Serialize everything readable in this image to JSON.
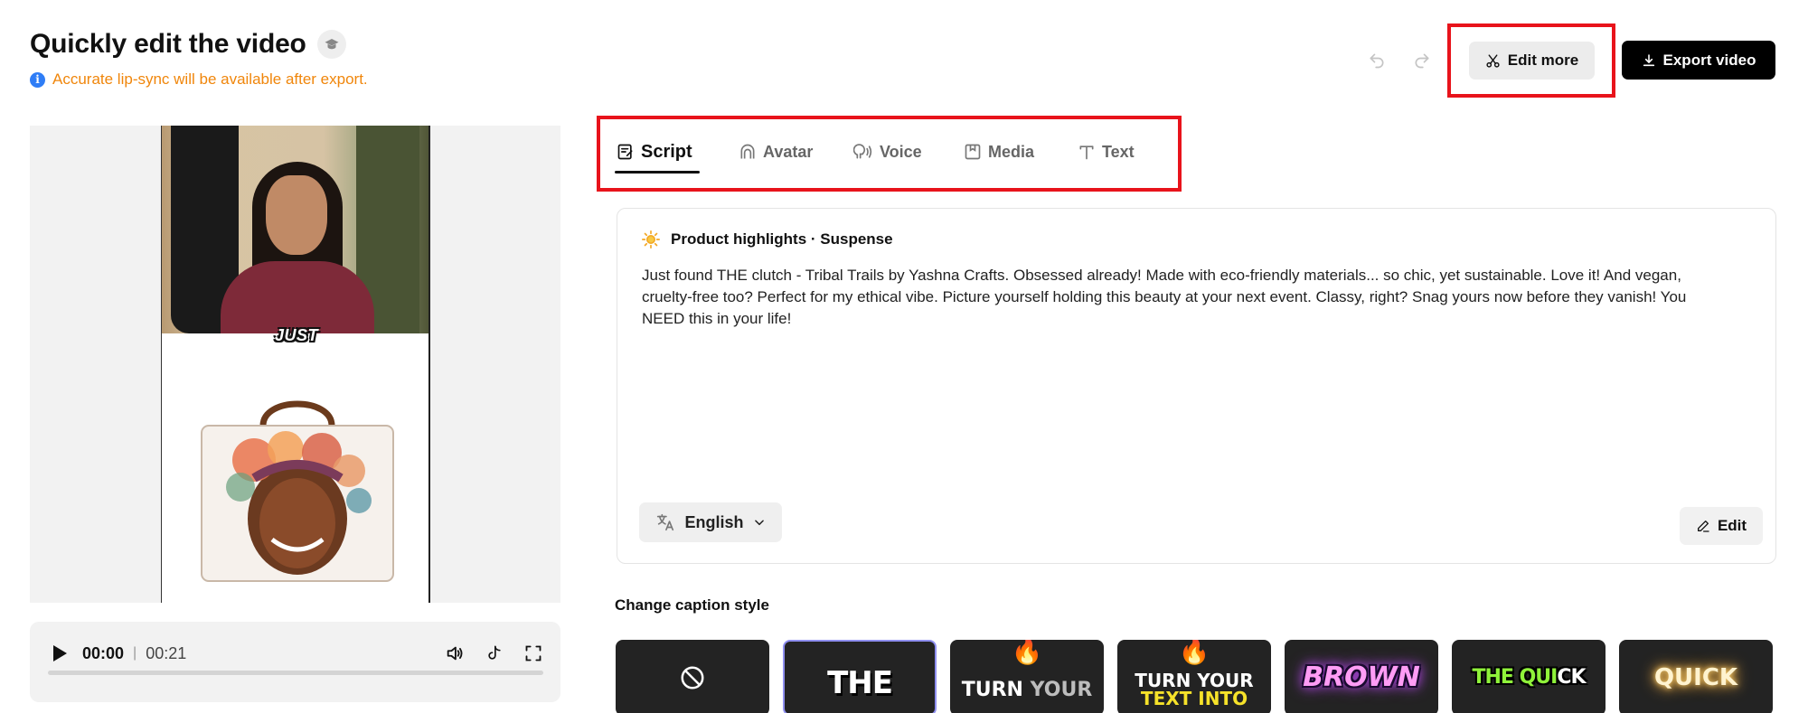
{
  "header": {
    "title": "Quickly edit the video",
    "notice": "Accurate lip-sync will be available after export.",
    "edit_more_label": "Edit more",
    "export_label": "Export video"
  },
  "preview": {
    "caption_overlay": "JUST"
  },
  "player": {
    "current_time": "00:00",
    "separator": "|",
    "total_time": "00:21",
    "progress": 0
  },
  "tabs": [
    {
      "label": "Script",
      "icon": "script-icon",
      "active": true
    },
    {
      "label": "Avatar",
      "icon": "avatar-icon",
      "active": false
    },
    {
      "label": "Voice",
      "icon": "voice-icon",
      "active": false
    },
    {
      "label": "Media",
      "icon": "media-icon",
      "active": false
    },
    {
      "label": "Text",
      "icon": "text-icon",
      "active": false
    }
  ],
  "script": {
    "header": "Product highlights · Suspense",
    "body": "Just found THE clutch - Tribal Trails by Yashna Crafts. Obsessed already! Made with eco-friendly materials... so chic, yet sustainable. Love it! And vegan, cruelty-free too? Perfect for my ethical vibe. Picture yourself holding this beauty at your next event. Classy, right? Snag yours now before they vanish! You NEED this in your life!",
    "language": "English",
    "edit_label": "Edit"
  },
  "captions": {
    "title": "Change caption style",
    "options": [
      {
        "id": "none",
        "icon": "no-caption-icon"
      },
      {
        "id": "the",
        "text": "THE",
        "selected": true
      },
      {
        "id": "turn-your",
        "text1": "TURN",
        "text2": "YOUR"
      },
      {
        "id": "turn-your-text-into",
        "line1": "TURN YOUR",
        "line2": "TEXT INTO"
      },
      {
        "id": "brown",
        "text": "BROWN"
      },
      {
        "id": "the-quick",
        "text1": "THE QUI",
        "text2": "CK"
      },
      {
        "id": "quick",
        "text": "QUICK"
      }
    ]
  },
  "colors": {
    "notice": "#f0860b",
    "highlight_box": "#e8131b",
    "export_bg": "#000000"
  }
}
